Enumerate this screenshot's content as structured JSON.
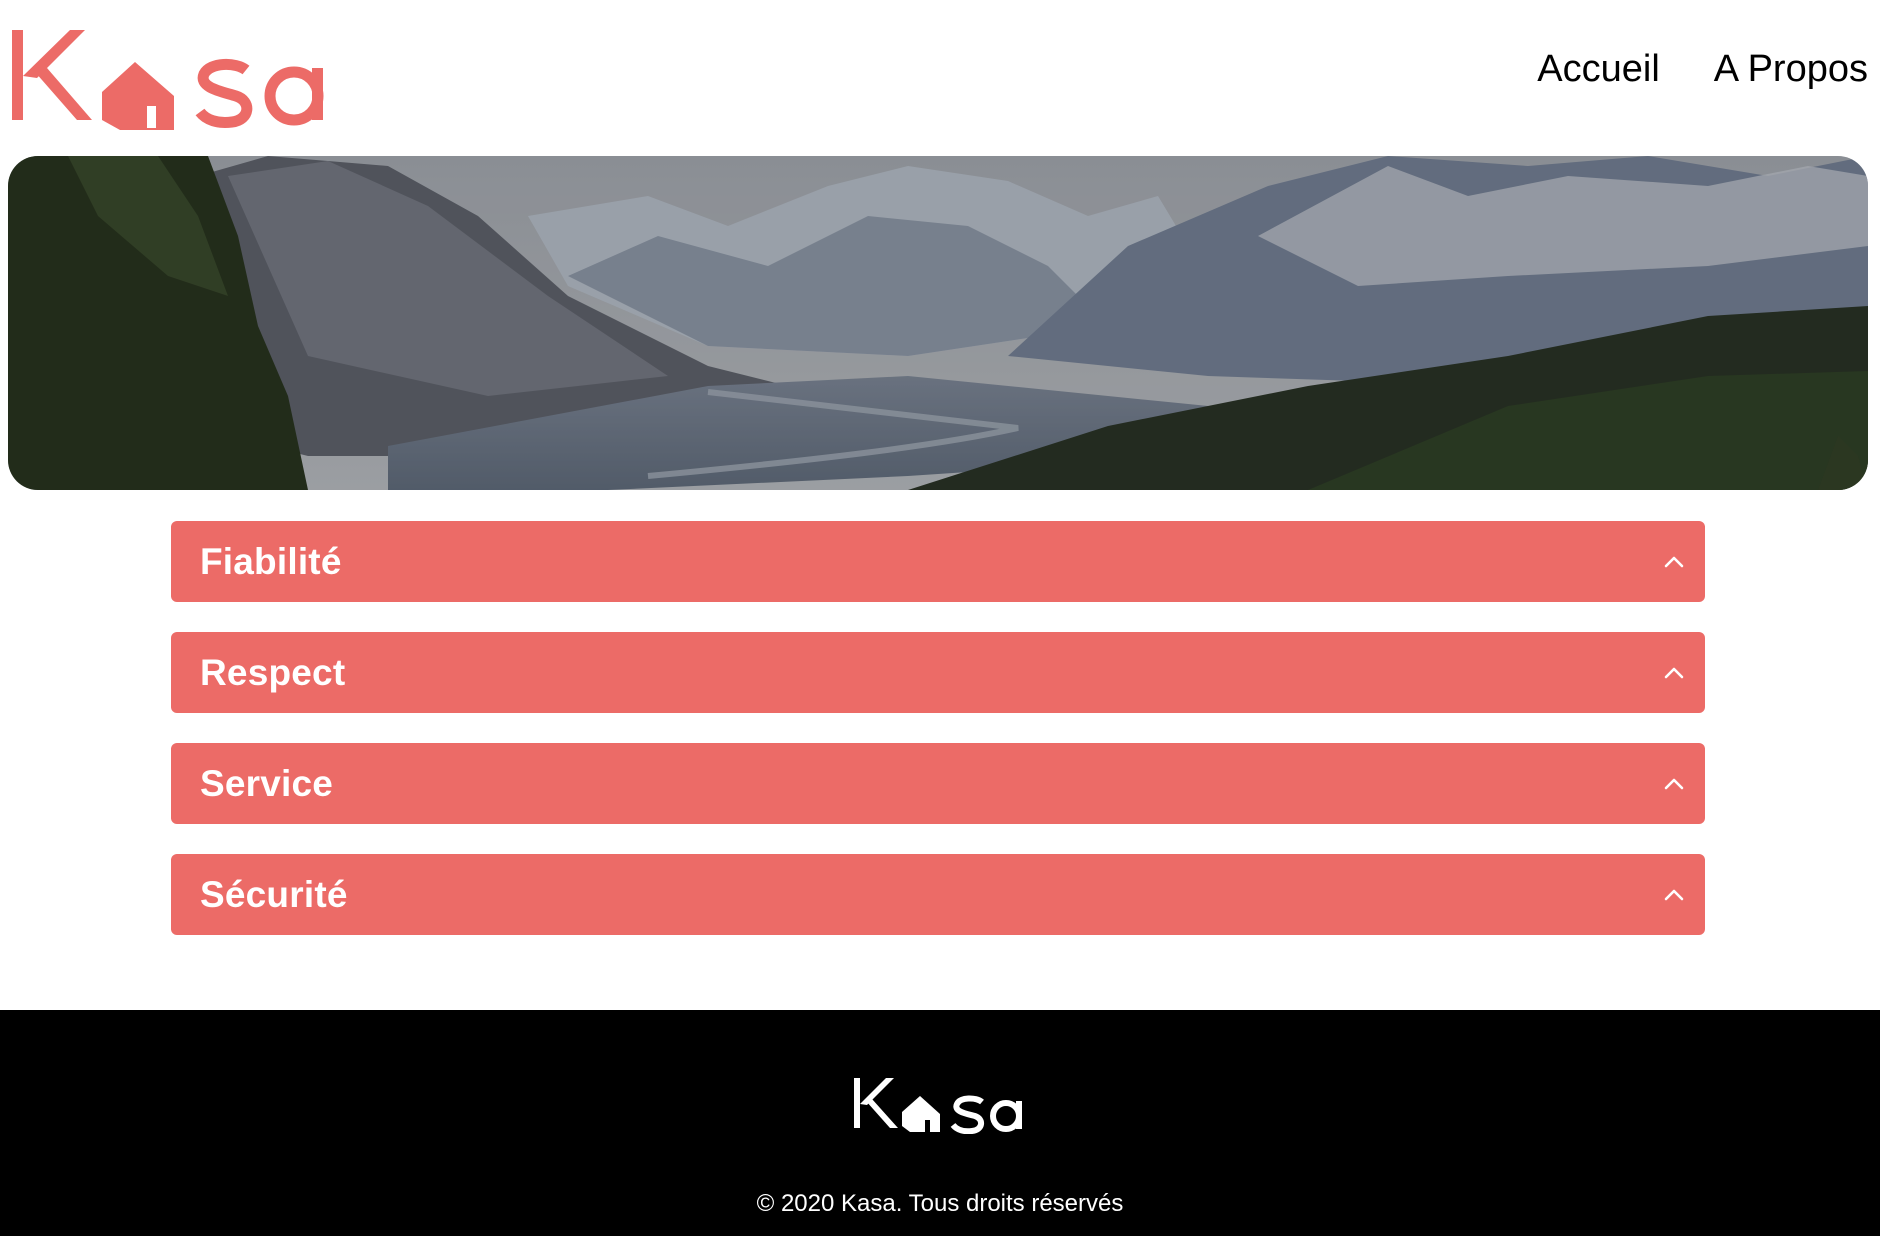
{
  "brand": {
    "name": "Kasa",
    "accent_color": "#ec6b67",
    "logo_icon": "house-icon"
  },
  "nav": {
    "items": [
      {
        "label": "Accueil"
      },
      {
        "label": "A Propos"
      }
    ]
  },
  "banner": {
    "image": "mountain-landscape-banner"
  },
  "collapses": [
    {
      "title": "Fiabilité",
      "icon": "chevron-up-icon"
    },
    {
      "title": "Respect",
      "icon": "chevron-up-icon"
    },
    {
      "title": "Service",
      "icon": "chevron-up-icon"
    },
    {
      "title": "Sécurité",
      "icon": "chevron-up-icon"
    }
  ],
  "footer": {
    "background": "#000000",
    "copyright": "© 2020 Kasa. Tous droits réservés"
  }
}
